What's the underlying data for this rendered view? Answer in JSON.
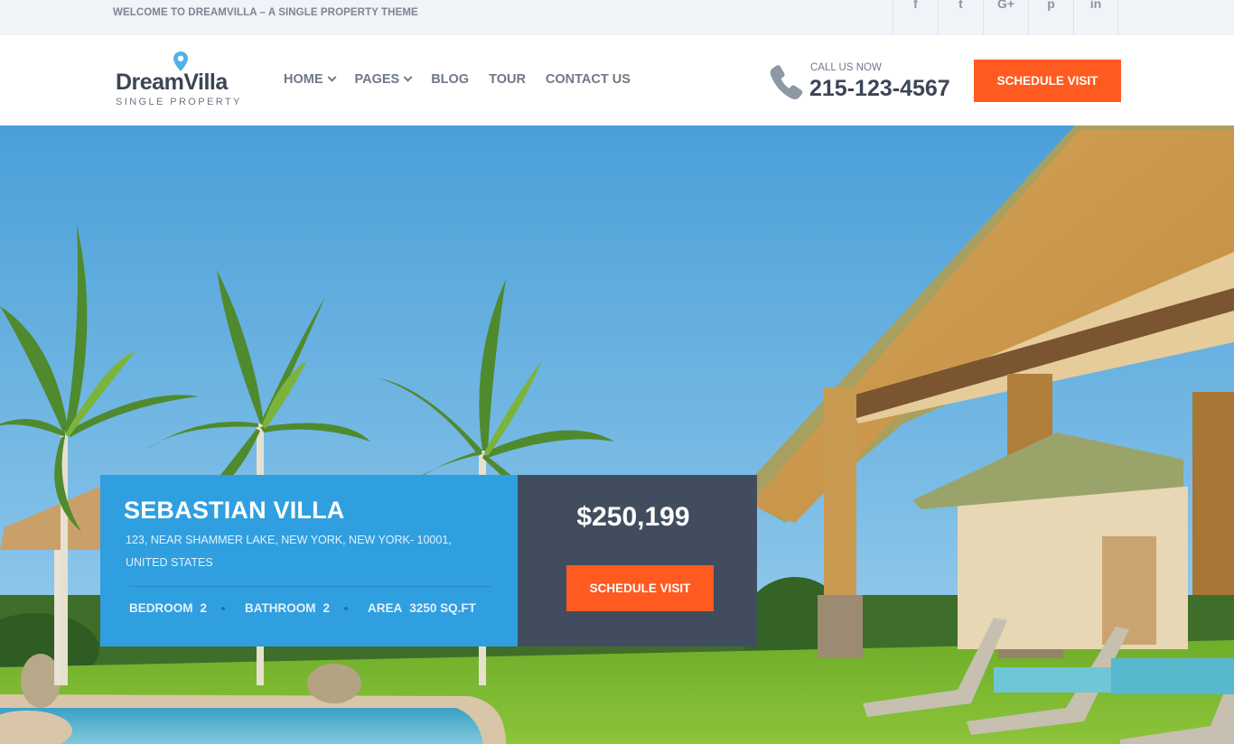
{
  "topbar": {
    "welcome": "WELCOME TO DREAMVILLA – A SINGLE PROPERTY THEME",
    "social": [
      {
        "name": "facebook-icon",
        "glyph": "f"
      },
      {
        "name": "twitter-icon",
        "glyph": "t"
      },
      {
        "name": "google-plus-icon",
        "glyph": "G+"
      },
      {
        "name": "pinterest-icon",
        "glyph": "p"
      },
      {
        "name": "linkedin-icon",
        "glyph": "in"
      }
    ]
  },
  "header": {
    "logo_name": "DreamVilla",
    "logo_tagline": "SINGLE PROPERTY",
    "nav": [
      {
        "label": "HOME",
        "dropdown": true
      },
      {
        "label": "PAGES",
        "dropdown": true
      },
      {
        "label": "BLOG",
        "dropdown": false
      },
      {
        "label": "TOUR",
        "dropdown": false
      },
      {
        "label": "CONTACT US",
        "dropdown": false
      }
    ],
    "call_label": "CALL US NOW",
    "phone": "215-123-4567",
    "cta": "SCHEDULE VISIT"
  },
  "property": {
    "title": "SEBASTIAN VILLA",
    "address": "123, NEAR SHAMMER LAKE, NEW YORK, NEW YORK- 10001, UNITED STATES",
    "specs": [
      {
        "label": "BEDROOM",
        "value": "2"
      },
      {
        "label": "BATHROOM",
        "value": "2"
      },
      {
        "label": "AREA",
        "value": "3250 SQ.FT"
      }
    ],
    "price": "$250,199",
    "cta": "SCHEDULE VISIT"
  },
  "colors": {
    "accent": "#ff5a1f",
    "card_blue": "#2f9fe0",
    "card_dark": "#414c5e",
    "text_dark": "#3c4555",
    "pin_blue": "#4fb3e8"
  }
}
